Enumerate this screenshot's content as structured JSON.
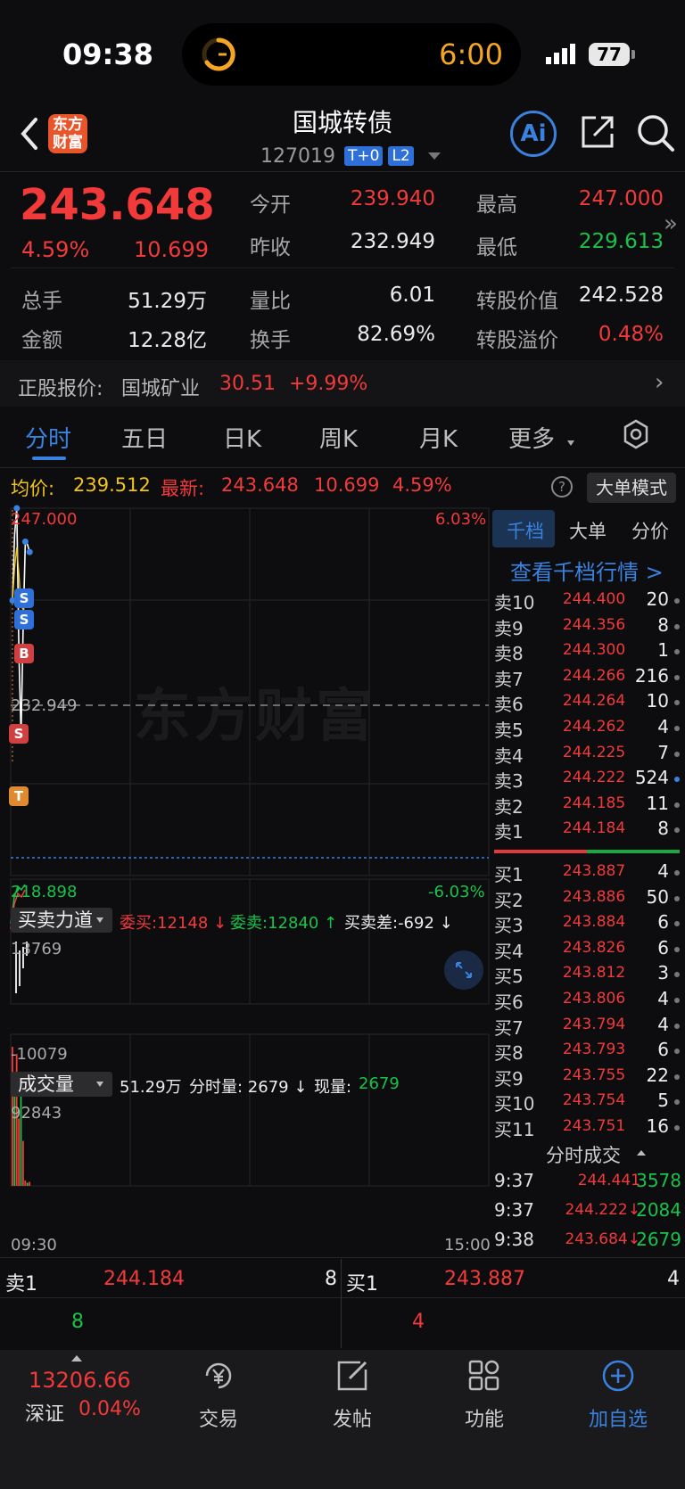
{
  "status_bar": {
    "time": "09:38",
    "timer": "6:00",
    "battery": "77"
  },
  "header": {
    "logo_text": "东方财富",
    "title": "国城转债",
    "code": "127019",
    "tags": [
      "T+0",
      "L2"
    ],
    "ai_label": "Ai"
  },
  "quote": {
    "price": "243.648",
    "change_pct": "4.59%",
    "change": "10.699",
    "labels": {
      "open": "今开",
      "prev_close": "昨收",
      "high": "最高",
      "low": "最低",
      "volume": "总手",
      "amount": "金额",
      "vol_ratio": "量比",
      "turnover": "换手",
      "conv_value": "转股价值",
      "conv_premium": "转股溢价"
    },
    "values": {
      "open": "239.940",
      "prev_close": "232.949",
      "high": "247.000",
      "low": "229.613",
      "volume": "51.29万",
      "amount": "12.28亿",
      "vol_ratio": "6.01",
      "turnover": "82.69%",
      "conv_value": "242.528",
      "conv_premium": "0.48%"
    }
  },
  "underlying": {
    "label": "正股报价:",
    "name": "国城矿业",
    "price": "30.51",
    "pct": "+9.99%"
  },
  "tabs": [
    "分时",
    "五日",
    "日K",
    "周K",
    "月K",
    "更多"
  ],
  "avg_row": {
    "avg_label": "均价:",
    "avg_value": "239.512",
    "latest_label": "最新:",
    "latest_price": "243.648",
    "latest_change": "10.699",
    "latest_pct": "4.59%",
    "help": "?",
    "mode_button": "大单模式"
  },
  "chart": {
    "top_price": "247.000",
    "top_pct": "6.03%",
    "mid_price": "232.949",
    "bottom_price": "218.898",
    "bottom_pct": "-6.03%",
    "watermark": "东方财富",
    "markers": {
      "s": "S",
      "b": "B",
      "t": "T"
    },
    "force_dropdown": "买卖力道",
    "force_bid": "委买:12148 ↓",
    "force_ask": "委卖:12840 ↑",
    "force_diff": "买卖差:-692 ↓",
    "force_top": "13769",
    "force_bottom": "-10079",
    "vol_dropdown": "成交量",
    "vol_total": "51.29万",
    "vol_tick_label": "分时量: 2679 ↓",
    "vol_now_label": "现量:",
    "vol_now": "2679",
    "vol_top": "92843",
    "time_start": "09:30",
    "time_end": "15:00"
  },
  "chart_data": {
    "type": "line",
    "title": "",
    "x": [
      "09:30",
      "09:31",
      "09:32",
      "09:33",
      "09:34",
      "09:35",
      "09:36",
      "09:37",
      "09:38"
    ],
    "series": [
      {
        "values": [
          239.94,
          245.0,
          247.0,
          236.0,
          229.613,
          238.0,
          244.441,
          244.222,
          243.648
        ]
      }
    ],
    "ylim": [
      218.898,
      247.0
    ],
    "reference": 232.949,
    "volume": [
      92843,
      70000,
      88000,
      45000,
      60000,
      30000,
      3578,
      2084,
      2679
    ]
  },
  "order_book": {
    "tabs": [
      "千档",
      "大单",
      "分价"
    ],
    "view_link": "查看千档行情 >",
    "asks": [
      {
        "label": "卖10",
        "price": "244.400",
        "qty": "20"
      },
      {
        "label": "卖9",
        "price": "244.356",
        "qty": "8"
      },
      {
        "label": "卖8",
        "price": "244.300",
        "qty": "1"
      },
      {
        "label": "卖7",
        "price": "244.266",
        "qty": "216"
      },
      {
        "label": "卖6",
        "price": "244.264",
        "qty": "10"
      },
      {
        "label": "卖5",
        "price": "244.262",
        "qty": "4"
      },
      {
        "label": "卖4",
        "price": "244.225",
        "qty": "7"
      },
      {
        "label": "卖3",
        "price": "244.222",
        "qty": "524"
      },
      {
        "label": "卖2",
        "price": "244.185",
        "qty": "11"
      },
      {
        "label": "卖1",
        "price": "244.184",
        "qty": "8"
      }
    ],
    "bids": [
      {
        "label": "买1",
        "price": "243.887",
        "qty": "4"
      },
      {
        "label": "买2",
        "price": "243.886",
        "qty": "50"
      },
      {
        "label": "买3",
        "price": "243.884",
        "qty": "6"
      },
      {
        "label": "买4",
        "price": "243.826",
        "qty": "6"
      },
      {
        "label": "买5",
        "price": "243.812",
        "qty": "3"
      },
      {
        "label": "买6",
        "price": "243.806",
        "qty": "4"
      },
      {
        "label": "买7",
        "price": "243.794",
        "qty": "4"
      },
      {
        "label": "买8",
        "price": "243.793",
        "qty": "6"
      },
      {
        "label": "买9",
        "price": "243.755",
        "qty": "22"
      },
      {
        "label": "买10",
        "price": "243.754",
        "qty": "5"
      },
      {
        "label": "买11",
        "price": "243.751",
        "qty": "16"
      }
    ],
    "ticks_title": "分时成交",
    "ticks": [
      {
        "time": "9:37",
        "price": "244.441",
        "qty": "3578"
      },
      {
        "time": "9:37",
        "price": "244.222↓",
        "qty": "2084"
      },
      {
        "time": "9:38",
        "price": "243.684↓",
        "qty": "2679"
      }
    ]
  },
  "bottom_strip": {
    "ask_label": "卖1",
    "ask_price": "244.184",
    "ask_qty": "8",
    "bid_label": "买1",
    "bid_price": "243.887",
    "bid_qty": "4",
    "ask_count": "8",
    "bid_count": "4"
  },
  "nav": {
    "index_value": "13206.66",
    "index_name": "深证",
    "index_pct": "0.04%",
    "items": [
      "交易",
      "发帖",
      "功能",
      "加自选"
    ]
  },
  "colors": {
    "up": "#f23a3a",
    "down": "#19c24a",
    "accent": "#3a82e0",
    "bg": "#0d0d0f"
  }
}
